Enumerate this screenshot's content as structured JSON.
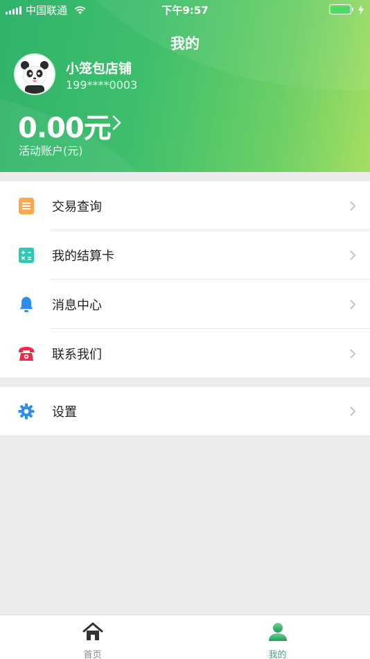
{
  "status_bar": {
    "carrier": "中国联通",
    "time": "下午9:57"
  },
  "header": {
    "title": "我的",
    "shop_name": "小笼包店铺",
    "phone": "199****0003",
    "balance": "0.00元",
    "balance_label": "活动账户(元)"
  },
  "menu": {
    "group1": [
      {
        "label": "交易查询",
        "icon": "document-icon"
      },
      {
        "label": "我的结算卡",
        "icon": "calculator-icon"
      },
      {
        "label": "消息中心",
        "icon": "bell-icon"
      },
      {
        "label": "联系我们",
        "icon": "phone-icon"
      }
    ],
    "group2": [
      {
        "label": "设置",
        "icon": "gear-icon"
      }
    ]
  },
  "tabbar": {
    "home_label": "首页",
    "mine_label": "我的"
  },
  "colors": {
    "accent": "#2fb36b",
    "document_icon": "#f7a94b",
    "calculator_icon": "#2cc9b5",
    "bell_icon": "#2c8ff0",
    "phone_icon": "#ef2a48",
    "gear_icon": "#2c8ff0"
  }
}
